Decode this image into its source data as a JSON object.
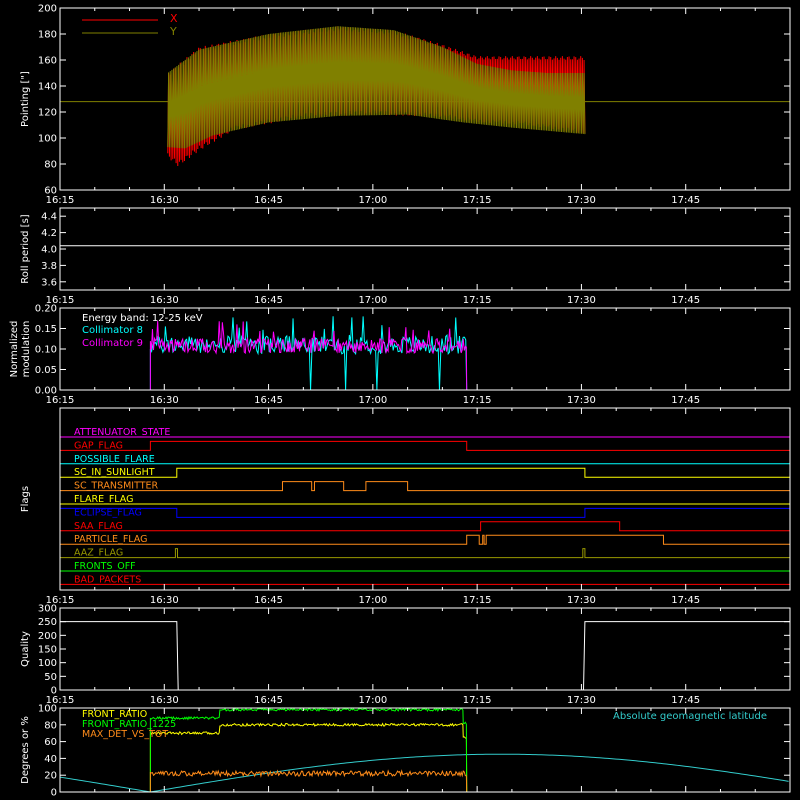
{
  "colors": {
    "background": "#000000",
    "axes": "#ffffff",
    "x_series": "#ff0000",
    "y_series": "#808000",
    "white": "#ffffff",
    "cyan": "#00ffff",
    "magenta": "#ff00ff",
    "yellow": "#ffff00",
    "green": "#00ff00",
    "orange": "#ff8c1a",
    "blue": "#0000ff",
    "red": "#ff0000",
    "olive": "#999900",
    "geomag": "#33cccc"
  },
  "time_ticks": [
    "16:15",
    "16:30",
    "16:45",
    "17:00",
    "17:15",
    "17:30",
    "17:45"
  ],
  "chart_data": [
    {
      "id": "pointing",
      "type": "line",
      "ylabel": "Pointing [\"]",
      "ylim": [
        60,
        200
      ],
      "yticks": [
        60,
        80,
        100,
        120,
        140,
        160,
        180,
        200
      ],
      "xlim_min": [
        0,
        105
      ],
      "legend": [
        "X",
        "Y"
      ],
      "series": [
        {
          "name": "X",
          "color": "#ff0000",
          "baseline_before": 128,
          "start_min": 15.5,
          "end_min": 75.5,
          "upper_envelope": [
            [
              15.5,
              150
            ],
            [
              20,
              170
            ],
            [
              30,
              180
            ],
            [
              40,
              186
            ],
            [
              48,
              183
            ],
            [
              55,
              172
            ],
            [
              60,
              163
            ],
            [
              65,
              163
            ],
            [
              70,
              163
            ],
            [
              75.5,
              163
            ]
          ],
          "lower_envelope": [
            [
              15.5,
              85
            ],
            [
              17,
              78
            ],
            [
              20,
              90
            ],
            [
              25,
              106
            ],
            [
              35,
              116
            ],
            [
              45,
              118
            ],
            [
              55,
              116
            ],
            [
              60,
              112
            ],
            [
              67,
              110
            ],
            [
              75.5,
              103
            ]
          ]
        },
        {
          "name": "Y",
          "color": "#808000",
          "baseline": 128,
          "start_min": 15.5,
          "end_min": 75.5,
          "upper_envelope": [
            [
              15.5,
              150
            ],
            [
              20,
              168
            ],
            [
              30,
              180
            ],
            [
              40,
              186
            ],
            [
              48,
              183
            ],
            [
              55,
              170
            ],
            [
              60,
              157
            ],
            [
              65,
              152
            ],
            [
              70,
              150
            ],
            [
              75.5,
              150
            ]
          ],
          "lower_envelope": [
            [
              15.5,
              93
            ],
            [
              18,
              92
            ],
            [
              22,
              102
            ],
            [
              30,
              112
            ],
            [
              40,
              117
            ],
            [
              50,
              118
            ],
            [
              58,
              112
            ],
            [
              65,
              108
            ],
            [
              75.5,
              103
            ]
          ]
        }
      ]
    },
    {
      "id": "roll",
      "type": "line",
      "ylabel": "Roll period [s]",
      "ylim": [
        3.5,
        4.5
      ],
      "yticks": [
        3.6,
        3.8,
        4.0,
        4.2,
        4.4
      ],
      "ytick_labels": [
        "3.6",
        "3.8",
        "4.0",
        "4.2",
        "4.4"
      ],
      "series": [
        {
          "name": "",
          "color": "#ffffff",
          "value": 4.04,
          "range_min": [
            0,
            105
          ]
        }
      ]
    },
    {
      "id": "modulation",
      "type": "line",
      "ylabel": "Normalized modulation",
      "ylabel_lines": [
        "Normalized",
        "modulation"
      ],
      "ylim": [
        0,
        0.2
      ],
      "yticks": [
        0,
        0.05,
        0.1,
        0.15,
        0.2
      ],
      "ytick_labels": [
        "0.00",
        "0.05",
        "0.10",
        "0.15",
        "0.20"
      ],
      "annotation": "Energy band: 12-25 keV",
      "active_range_min": [
        13,
        58.5
      ],
      "series": [
        {
          "name": "Collimator 8",
          "color": "#00ffff",
          "mean": 0.11,
          "spread": 0.022,
          "dropouts_min": [
            36,
            41,
            45.5,
            54.5
          ]
        },
        {
          "name": "Collimator 9",
          "color": "#ff00ff",
          "mean": 0.108,
          "spread": 0.018
        }
      ]
    },
    {
      "id": "flags",
      "type": "line",
      "ylabel": "Flags",
      "series": [
        {
          "name": "ATTENUATOR_STATE",
          "color": "#ff00ff",
          "steps": []
        },
        {
          "name": "GAP_FLAG",
          "color": "#ff0000",
          "steps": [
            [
              0,
              0
            ],
            [
              13,
              1
            ],
            [
              58.5,
              0
            ],
            [
              105,
              0
            ]
          ]
        },
        {
          "name": "POSSIBLE_FLARE",
          "color": "#00ffff",
          "steps": []
        },
        {
          "name": "SC_IN_SUNLIGHT",
          "color": "#ffff00",
          "steps": [
            [
              0,
              0
            ],
            [
              16.8,
              1
            ],
            [
              75.5,
              0
            ],
            [
              105,
              0
            ]
          ]
        },
        {
          "name": "SC_TRANSMITTER",
          "color": "#ff8c1a",
          "steps": [
            [
              0,
              0
            ],
            [
              32,
              1
            ],
            [
              36.2,
              0
            ],
            [
              36.6,
              1
            ],
            [
              40.8,
              0
            ],
            [
              44,
              1
            ],
            [
              50,
              0
            ],
            [
              105,
              0
            ]
          ]
        },
        {
          "name": "FLARE_FLAG",
          "color": "#ffff00",
          "steps": []
        },
        {
          "name": "ECLIPSE_FLAG",
          "color": "#0000ff",
          "steps": [
            [
              0,
              1
            ],
            [
              16.8,
              0
            ],
            [
              75.5,
              1
            ],
            [
              105,
              1
            ]
          ]
        },
        {
          "name": "SAA_FLAG",
          "color": "#ff0000",
          "steps": [
            [
              0,
              0
            ],
            [
              60.5,
              1
            ],
            [
              80.5,
              0
            ],
            [
              105,
              0
            ]
          ]
        },
        {
          "name": "PARTICLE_FLAG",
          "color": "#ff8c1a",
          "steps": [
            [
              0,
              0
            ],
            [
              58.5,
              1
            ],
            [
              60.3,
              0
            ],
            [
              60.8,
              1
            ],
            [
              61,
              0
            ],
            [
              61.3,
              1
            ],
            [
              86.8,
              0
            ],
            [
              105,
              0
            ]
          ]
        },
        {
          "name": "AAZ_FLAG",
          "color": "#999900",
          "steps": [
            [
              0,
              0
            ],
            [
              16.6,
              1
            ],
            [
              16.9,
              0
            ],
            [
              75.2,
              1
            ],
            [
              75.5,
              0
            ],
            [
              105,
              0
            ]
          ]
        },
        {
          "name": "FRONTS_OFF",
          "color": "#00ff00",
          "steps": []
        },
        {
          "name": "BAD_PACKETS",
          "color": "#ff0000",
          "steps": []
        }
      ]
    },
    {
      "id": "quality",
      "type": "line",
      "ylabel": "Quality",
      "ylim": [
        0,
        300
      ],
      "yticks": [
        0,
        50,
        100,
        150,
        200,
        250,
        300
      ],
      "series": [
        {
          "name": "",
          "color": "#ffffff",
          "steps": [
            [
              0,
              250
            ],
            [
              16.8,
              250
            ],
            [
              17,
              0
            ],
            [
              75.3,
              0
            ],
            [
              75.5,
              250
            ],
            [
              105,
              250
            ]
          ]
        }
      ]
    },
    {
      "id": "ratios",
      "type": "line",
      "ylabel": "Degrees or %",
      "ylim": [
        0,
        100
      ],
      "yticks": [
        0,
        20,
        40,
        60,
        80,
        100
      ],
      "legend_right": "Absolute geomagnetic latitude",
      "series": [
        {
          "name": "FRONT_RATIO",
          "color": "#ffff00",
          "segments": [
            [
              13,
              23,
              70
            ],
            [
              23,
              58,
              80
            ],
            [
              58,
              58.5,
              65
            ]
          ]
        },
        {
          "name": "FRONT_RATIO_1225",
          "color": "#00ff00",
          "segments": [
            [
              13,
              23,
              88
            ],
            [
              23,
              58,
              98
            ],
            [
              58,
              58.5,
              82
            ]
          ]
        },
        {
          "name": "MAX_DET_VS_TOT",
          "color": "#ff8c1a",
          "segments": [
            [
              13,
              58.5,
              22
            ]
          ]
        },
        {
          "name": "Absolute geomagnetic latitude",
          "color": "#33cccc",
          "points": [
            [
              0,
              30
            ],
            [
              13,
              0
            ],
            [
              43,
              45
            ],
            [
              63.5,
              0
            ],
            [
              89,
              45
            ],
            [
              105,
              23
            ]
          ]
        }
      ]
    }
  ]
}
